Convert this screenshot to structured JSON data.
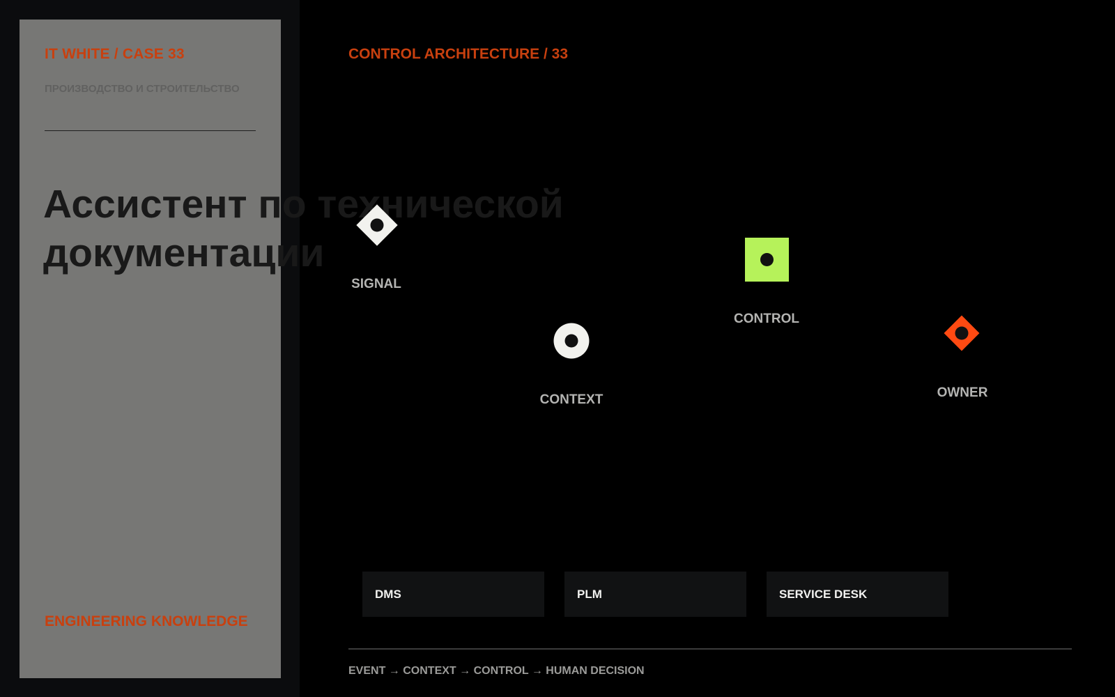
{
  "card": {
    "eyebrow": "IT WHITE / CASE 33",
    "subtitle": "ПРОИЗВОДСТВО И СТРОИТЕЛЬСТВО",
    "title": "Ассистент по технической документации",
    "footer": "ENGINEERING KNOWLEDGE"
  },
  "main": {
    "section_title": "CONTROL ARCHITECTURE / 33",
    "nodes": [
      {
        "label": "SIGNAL",
        "shape": "diamond",
        "icon": "signal-diamond-icon",
        "color": "#f2f2ee"
      },
      {
        "label": "CONTEXT",
        "shape": "circle",
        "icon": "context-circle-icon",
        "color": "#f2f2ee"
      },
      {
        "label": "CONTROL",
        "shape": "square",
        "icon": "control-square-icon",
        "color": "#b6f25a"
      },
      {
        "label": "OWNER",
        "shape": "diamond",
        "icon": "owner-diamond-icon",
        "color": "#ff4a12"
      }
    ],
    "systems": [
      "DMS",
      "PLM",
      "SERVICE DESK"
    ],
    "flow": "EVENT → CONTEXT → CONTROL → HUMAN DECISION"
  },
  "colors": {
    "accent": "#c8400f",
    "card_bg": "#777775",
    "page_bg": "#000000",
    "rail_bg": "#0b0c0e",
    "system_bg": "#111213",
    "dot": "#111111"
  }
}
